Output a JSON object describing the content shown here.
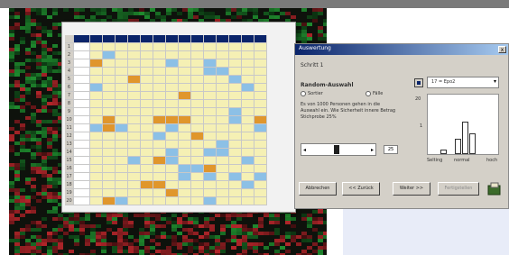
{
  "colors": {
    "heat_green": "#1f8a2e",
    "heat_red": "#b2262a",
    "title_bar": "#0a246a",
    "cell_yellow": "#f5f0b4",
    "cell_blue": "#8cc0e6",
    "cell_orange": "#e0962c"
  },
  "spreadsheet": {
    "row_labels": [
      "1",
      "2",
      "3",
      "4",
      "5",
      "6",
      "7",
      "8",
      "9",
      "10",
      "11",
      "12",
      "13",
      "14",
      "15",
      "16",
      "17",
      "18",
      "19",
      "20"
    ]
  },
  "dialog": {
    "title": "Auswertung",
    "close_label": "x",
    "tab_label": "Schritt 1",
    "heading": "Random-Auswahl",
    "radio_a_label": "Sortier",
    "radio_b_label": "Fälle",
    "description": "Es von 1000 Personen gehen in die Auswahl ein. Wie Sicherheit innere Betrag Stichprobe 25%",
    "slider_value": "25",
    "dropdown_value": "17 = Epo2",
    "hist_axis": [
      "20",
      "1"
    ],
    "hist_labels": [
      "Selting",
      "normal",
      "hoch"
    ],
    "buttons": [
      "Abbrechen",
      "<< Zurück",
      "Weiter >>",
      "Fertigstellen"
    ]
  },
  "histogram": {
    "values": [
      0.08,
      0.25,
      0.55,
      0.35
    ]
  }
}
